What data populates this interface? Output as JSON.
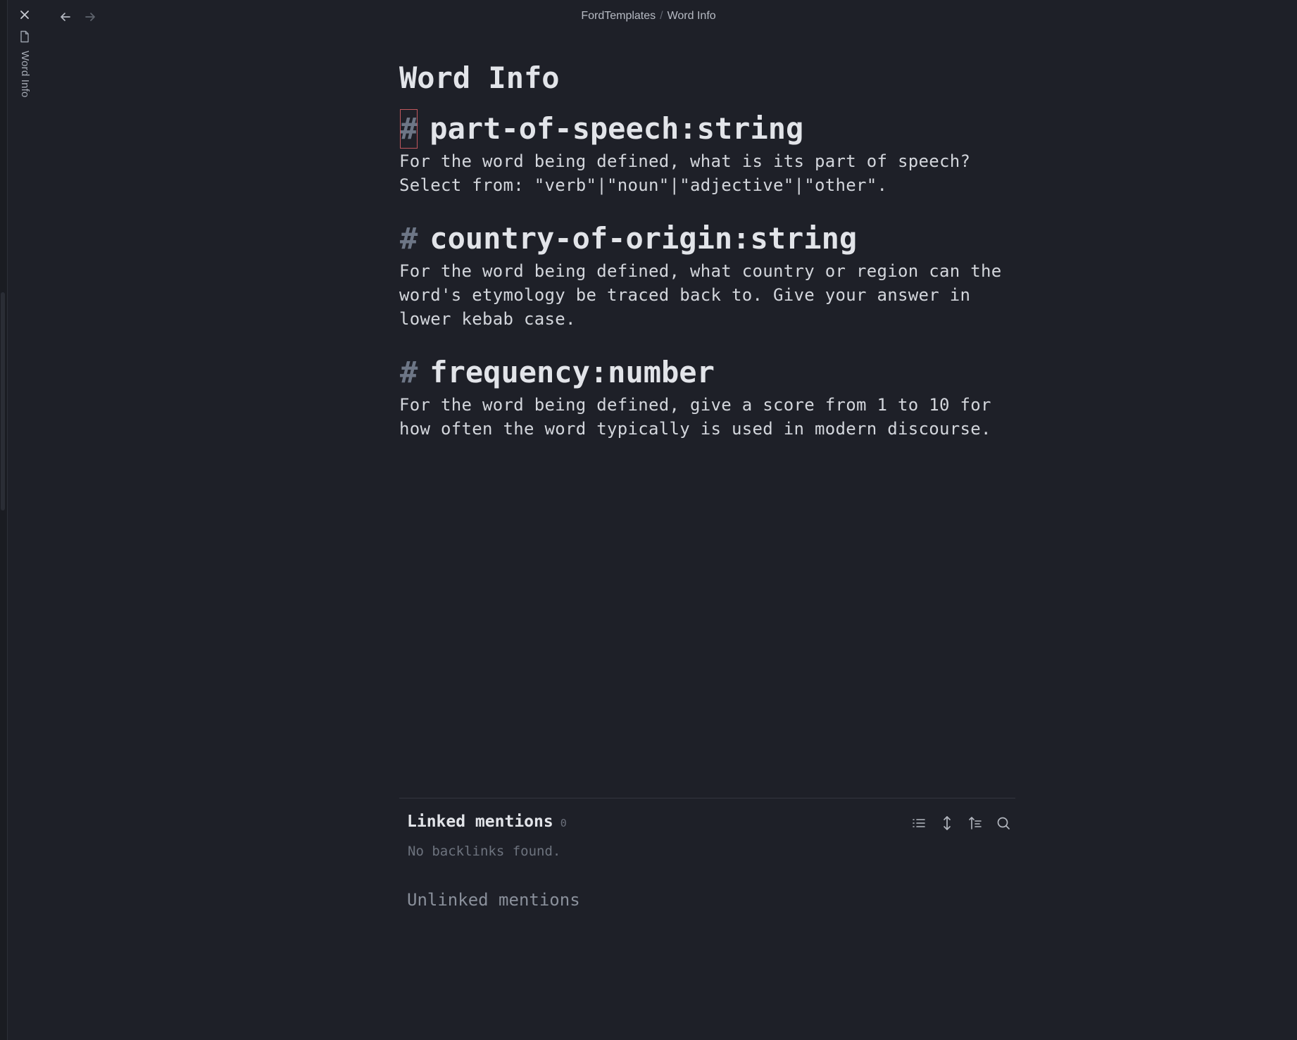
{
  "sidebar": {
    "tab_label": "Word Info"
  },
  "breadcrumb": {
    "folder": "FordTemplates",
    "separator": "/",
    "page": "Word Info"
  },
  "page": {
    "title": "Word Info",
    "fields": [
      {
        "hash": "#",
        "heading": "part-of-speech:string",
        "description": "For the word being defined, what is its part of speech? Select from: \"verb\"|\"noun\"|\"adjective\"|\"other\"."
      },
      {
        "hash": "#",
        "heading": "country-of-origin:string",
        "description": "For the word being defined, what country or region can the word's etymology be traced back to. Give your answer in lower kebab case."
      },
      {
        "hash": "#",
        "heading": "frequency:number",
        "description": "For the word being defined, give a score from 1 to 10 for how often the word typically is used in modern discourse."
      }
    ]
  },
  "backlinks": {
    "linked_title": "Linked mentions",
    "linked_count": "0",
    "empty_message": "No backlinks found.",
    "unlinked_title": "Unlinked mentions",
    "tools": [
      "list-icon",
      "expand-vertical-icon",
      "sort-icon",
      "search-icon"
    ]
  },
  "colors": {
    "background": "#1e2028",
    "text": "#e2e4e9",
    "muted": "#6d7686",
    "cursor_outline": "#c0575d"
  }
}
